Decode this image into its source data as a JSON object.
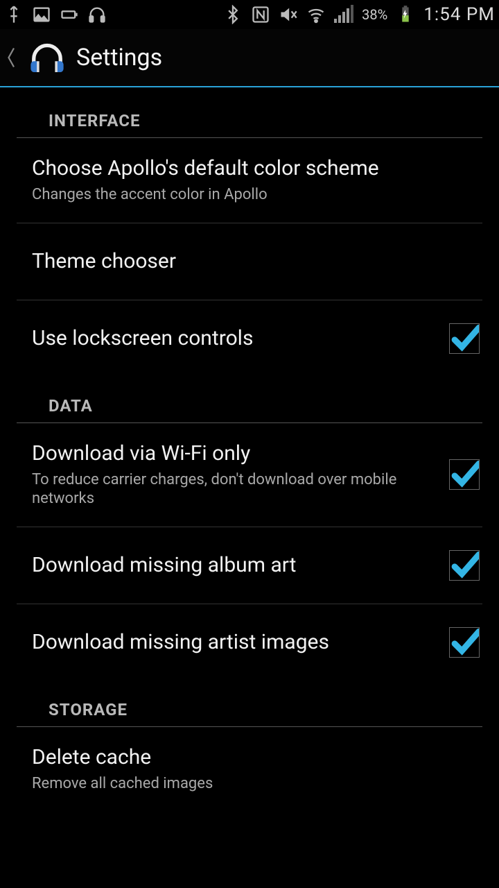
{
  "status": {
    "battery_pct": "38%",
    "clock": "1:54 PM"
  },
  "header": {
    "title": "Settings"
  },
  "sections": {
    "interface": {
      "label": "INTERFACE"
    },
    "data": {
      "label": "DATA"
    },
    "storage": {
      "label": "STORAGE"
    }
  },
  "prefs": {
    "color_scheme": {
      "title": "Choose Apollo's default color scheme",
      "sub": "Changes the accent color in Apollo"
    },
    "theme_chooser": {
      "title": "Theme chooser"
    },
    "lockscreen": {
      "title": "Use lockscreen controls",
      "checked": true
    },
    "wifi_only": {
      "title": "Download via Wi-Fi only",
      "sub": "To reduce carrier charges, don't download over mobile networks",
      "checked": true
    },
    "album_art": {
      "title": "Download missing album art",
      "checked": true
    },
    "artist_img": {
      "title": "Download missing artist images",
      "checked": true
    },
    "delete_cache": {
      "title": "Delete cache",
      "sub": "Remove all cached images"
    }
  },
  "colors": {
    "accent": "#33b5e5"
  }
}
